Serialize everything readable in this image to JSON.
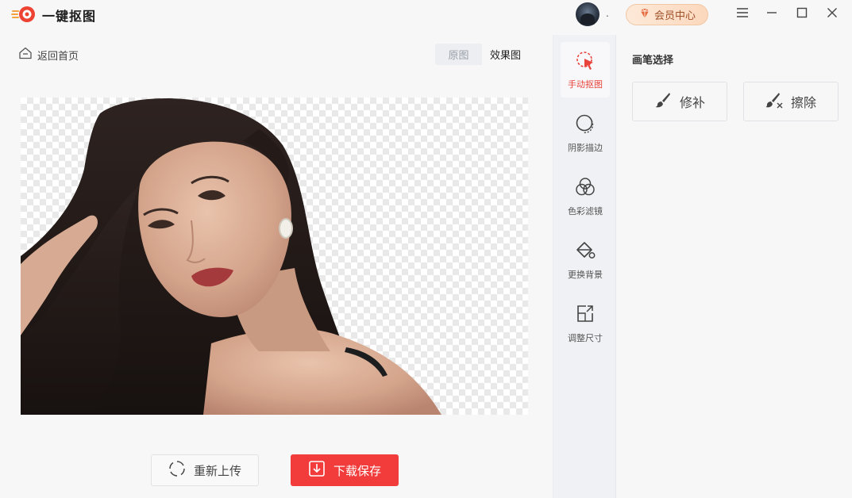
{
  "app": {
    "name": "一键抠图"
  },
  "user": {
    "name": "."
  },
  "header": {
    "vip_label": "会员中心"
  },
  "nav": {
    "back_label": "返回首页"
  },
  "view_toggle": {
    "original": "原图",
    "effect": "效果图",
    "selected": "效果图"
  },
  "zoom_tools": [
    "hand-icon",
    "zoom-out-icon",
    "zoom-in-icon",
    "fit-icon"
  ],
  "actions": {
    "reupload_label": "重新上传",
    "download_label": "下载保存"
  },
  "tools": [
    {
      "label": "手动抠图",
      "icon": "cursor-select-icon",
      "active": true
    },
    {
      "label": "阴影描边",
      "icon": "shadow-outline-icon",
      "active": false
    },
    {
      "label": "色彩滤镜",
      "icon": "color-filter-icon",
      "active": false
    },
    {
      "label": "更换背景",
      "icon": "paint-bucket-icon",
      "active": false
    },
    {
      "label": "调整尺寸",
      "icon": "resize-icon",
      "active": false
    }
  ],
  "panel": {
    "title": "画笔选择",
    "brushes": [
      {
        "label": "修补",
        "icon": "repair-brush-icon"
      },
      {
        "label": "擦除",
        "icon": "erase-brush-icon"
      }
    ]
  },
  "colors": {
    "accent": "#f23c3c",
    "vip_text": "#a0512a",
    "active_tool": "#e8423a"
  }
}
